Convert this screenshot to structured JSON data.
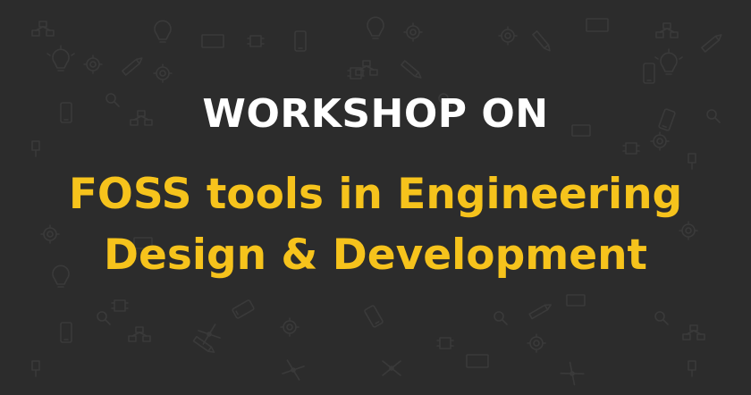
{
  "banner": {
    "kicker": "WORKSHOP ON",
    "title_line1": "FOSS tools in Engineering",
    "title_line2": "Design & Development"
  },
  "colors": {
    "background": "#2c2c2c",
    "pattern": "#3a3a3a",
    "kicker": "#ffffff",
    "title": "#f6c31c"
  },
  "pattern_icons": [
    "lightbulb-icon",
    "gear-icon",
    "chip-icon",
    "smartphone-icon",
    "monitor-icon",
    "pencil-icon",
    "magnifier-icon",
    "usb-plug-icon",
    "network-icon",
    "calipers-icon"
  ]
}
